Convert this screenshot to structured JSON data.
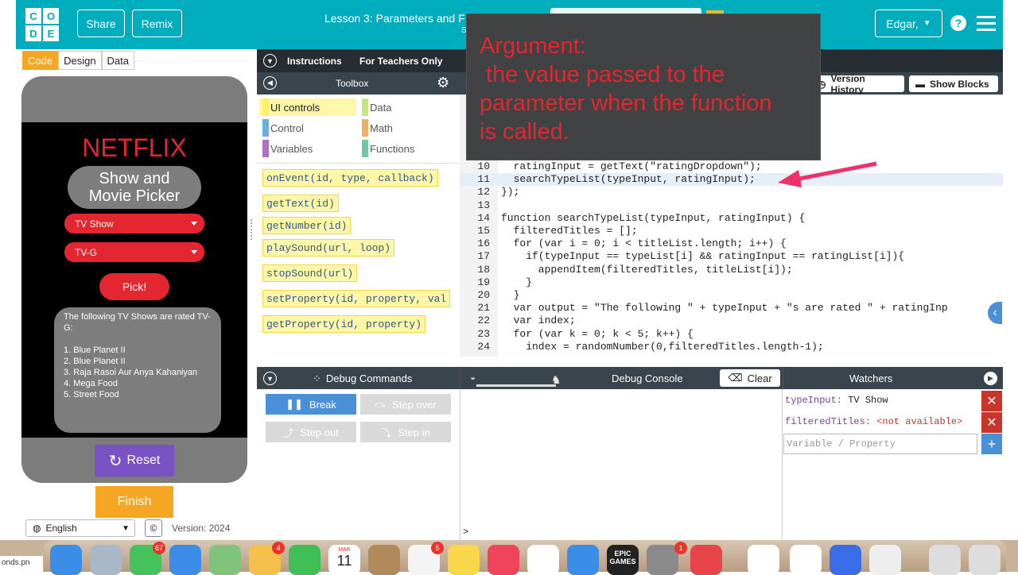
{
  "header": {
    "logo_letters": [
      "C",
      "O",
      "D",
      "E"
    ],
    "share": "Share",
    "remix": "Remix",
    "lesson_title": "Lesson 3: Parameters and F",
    "lesson_sub": "S",
    "user": "Edgar,",
    "help": "?"
  },
  "modes": [
    "Code",
    "Design",
    "Data"
  ],
  "app": {
    "brand": "NETFLIX",
    "title_line1": "Show and",
    "title_line2": "Movie Picker",
    "type_dropdown": "TV Show",
    "rating_dropdown": "TV-G",
    "pick_button": "Pick!",
    "result_intro": "The following TV Shows are rated TV-G:",
    "results": [
      "1. Blue Planet II",
      "2. Blue Planet II",
      "3. Raja Rasoi Aur Anya Kahaniyan",
      "4. Mega Food",
      "5. Street Food"
    ],
    "reset": "Reset",
    "finish": "Finish",
    "language": "English",
    "cc": "©",
    "version": "Version: 2024"
  },
  "instructions_bar": {
    "instructions": "Instructions",
    "teachers": "For Teachers Only"
  },
  "toolbox": {
    "title": "Toolbox"
  },
  "editor_head": {
    "version_history": "Version History",
    "show_blocks": "Show Blocks"
  },
  "categories": [
    "UI controls",
    "Control",
    "Variables",
    "Data",
    "Math",
    "Functions"
  ],
  "blocks": [
    "onEvent(id, type, callback)",
    "getText(id)",
    "getNumber(id)",
    "playSound(url, loop)",
    "stopSound(url)",
    "setProperty(id, property, val",
    "getProperty(id, property)"
  ],
  "code": {
    "line_numbers": [
      "10",
      "11",
      "12",
      "13",
      "14",
      "15",
      "16",
      "17",
      "18",
      "19",
      "20",
      "21",
      "22",
      "23",
      "24"
    ],
    "lines": [
      "  ratingInput = getText(\"ratingDropdown\");",
      "  searchTypeList(typeInput, ratingInput);",
      "});",
      "",
      "function searchTypeList(typeInput, ratingInput) {",
      "  filteredTitles = [];",
      "  for (var i = 0; i < titleList.length; i++) {",
      "    if(typeInput == typeList[i] && ratingInput == ratingList[i]){",
      "      appendItem(filteredTitles, titleList[i]);",
      "    }",
      "  }",
      "  var output = \"The following \" + typeInput + \"s are rated \" + ratingInp",
      "  var index;",
      "  for (var k = 0; k < 5; k++) {",
      "    index = randomNumber(0,filteredTitles.length-1);"
    ]
  },
  "tooltip": {
    "lines": [
      "Argument:",
      " the value passed to the",
      "parameter when the function",
      "is called."
    ]
  },
  "debug": {
    "commands": "Debug Commands",
    "console": "Debug Console",
    "clear": "Clear",
    "watchers": "Watchers",
    "break": "Break",
    "step_over": "Step over",
    "step_out": "Step out",
    "step_in": "Step in",
    "prompt": ">"
  },
  "watchers": {
    "items": [
      {
        "name": "typeInput:",
        "value": "TV Show"
      },
      {
        "name": "filteredTitles:",
        "value": "<not available>"
      }
    ],
    "placeholder": "Variable / Property",
    "remove": "✕",
    "add": "+"
  },
  "dock": {
    "filename": "onds.pn",
    "badges": [
      "67",
      "4",
      "5",
      "1"
    ],
    "calendar_month": "MAR",
    "calendar_day": "11",
    "epic_line1": "EPIC",
    "epic_line2": "GAMES"
  },
  "colors": {
    "teal": "#00adbc",
    "netflix_red": "#e3262f",
    "orange": "#f5a623",
    "purple": "#7b52c4",
    "dark": "#39444d"
  }
}
